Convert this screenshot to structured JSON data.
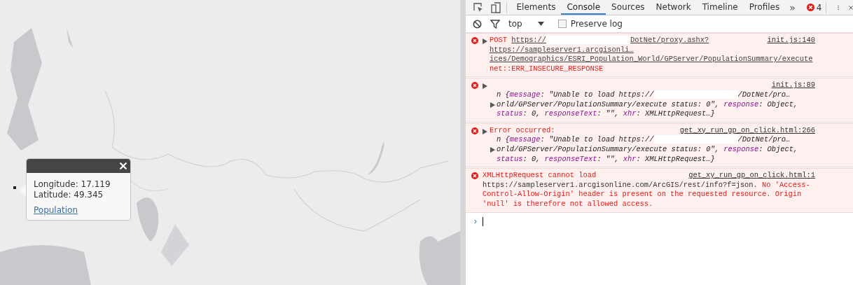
{
  "popup": {
    "lines": [
      "Longitude: 17.119",
      "Latitude: 49.345"
    ],
    "link": "Population"
  },
  "devtools": {
    "tabs": [
      {
        "label": "Elements",
        "selected": false
      },
      {
        "label": "Console",
        "selected": true
      },
      {
        "label": "Sources",
        "selected": false
      },
      {
        "label": "Network",
        "selected": false
      },
      {
        "label": "Timeline",
        "selected": false
      },
      {
        "label": "Profiles",
        "selected": false
      }
    ],
    "more_tabs": "»",
    "error_count": "4",
    "filter": {
      "context": "top",
      "preserve_log": {
        "label": "Preserve log",
        "checked": false
      }
    },
    "messages": [
      {
        "expandable": true,
        "source": "init.js:140",
        "lines": [
          {
            "kind": "text",
            "segments": [
              {
                "kind": "error",
                "text": "POST "
              },
              {
                "kind": "link",
                "text": "https://"
              },
              {
                "kind": "redacted"
              },
              {
                "kind": "link",
                "text": "DotNet/proxy.ashx?"
              }
            ]
          },
          {
            "kind": "text",
            "segments": [
              {
                "kind": "link",
                "text": "https://sampleserver1.arcgisonli…"
              }
            ]
          },
          {
            "kind": "text",
            "segments": [
              {
                "kind": "link",
                "text": "ices/Demographics/ESRI_Population_World/GPServer/PopulationSummary/execute"
              }
            ]
          },
          {
            "kind": "text",
            "segments": [
              {
                "kind": "error",
                "text": "net::ERR_INSECURE_RESPONSE"
              }
            ]
          }
        ]
      },
      {
        "expandable": true,
        "source": "init.js:89",
        "lines": [
          {
            "kind": "text"
          },
          {
            "kind": "object",
            "segments": [
              {
                "kind": "value",
                "text": "n {"
              },
              {
                "kind": "key",
                "text": "message"
              },
              {
                "kind": "value",
                "text": ": \"Unable to load https://"
              },
              {
                "kind": "redacted"
              },
              {
                "kind": "value",
                "text": "/DotNet/pro…"
              }
            ]
          },
          {
            "kind": "object-expandable",
            "segments": [
              {
                "kind": "value",
                "text": "orld/GPServer/PopulationSummary/execute status: 0\", "
              },
              {
                "kind": "key",
                "text": "response"
              },
              {
                "kind": "value",
                "text": ": Object,"
              }
            ]
          },
          {
            "kind": "object",
            "segments": [
              {
                "kind": "key",
                "text": "status"
              },
              {
                "kind": "value",
                "text": ": 0, "
              },
              {
                "kind": "key",
                "text": "responseText"
              },
              {
                "kind": "value",
                "text": ": \"\", "
              },
              {
                "kind": "key",
                "text": "xhr"
              },
              {
                "kind": "value",
                "text": ": XMLHttpRequest…}"
              }
            ]
          }
        ]
      },
      {
        "expandable": true,
        "source": "get_xy_run_gp_on_click.html:266",
        "lines": [
          {
            "kind": "text",
            "segments": [
              {
                "kind": "error",
                "text": "Error occurred:"
              }
            ]
          },
          {
            "kind": "object",
            "segments": [
              {
                "kind": "value",
                "text": "n {"
              },
              {
                "kind": "key",
                "text": "message"
              },
              {
                "kind": "value",
                "text": ": \"Unable to load https://"
              },
              {
                "kind": "redacted"
              },
              {
                "kind": "value",
                "text": "/DotNet/pro…"
              }
            ]
          },
          {
            "kind": "object-expandable",
            "segments": [
              {
                "kind": "value",
                "text": "orld/GPServer/PopulationSummary/execute status: 0\", "
              },
              {
                "kind": "key",
                "text": "response"
              },
              {
                "kind": "value",
                "text": ": Object,"
              }
            ]
          },
          {
            "kind": "object",
            "segments": [
              {
                "kind": "key",
                "text": "status"
              },
              {
                "kind": "value",
                "text": ": 0, "
              },
              {
                "kind": "key",
                "text": "responseText"
              },
              {
                "kind": "value",
                "text": ": \"\", "
              },
              {
                "kind": "key",
                "text": "xhr"
              },
              {
                "kind": "value",
                "text": ": XMLHttpRequest…}"
              }
            ]
          }
        ]
      },
      {
        "expandable": false,
        "source": "get_xy_run_gp_on_click.html:1",
        "lines": [
          {
            "kind": "text",
            "segments": [
              {
                "kind": "error",
                "text": "XMLHttpRequest cannot load"
              }
            ]
          },
          {
            "kind": "text",
            "segments": [
              {
                "kind": "plain",
                "text": "https://sampleserver1.arcgisonline.com/ArcGIS/rest/info?f=json."
              },
              {
                "kind": "error",
                "text": " No 'Access-"
              }
            ]
          },
          {
            "kind": "text",
            "segments": [
              {
                "kind": "error",
                "text": "Control-Allow-Origin' header is present on the requested resource. Origin"
              }
            ]
          },
          {
            "kind": "text",
            "segments": [
              {
                "kind": "error",
                "text": "'null' is therefore not allowed access."
              }
            ]
          }
        ]
      }
    ],
    "prompt": "›"
  }
}
